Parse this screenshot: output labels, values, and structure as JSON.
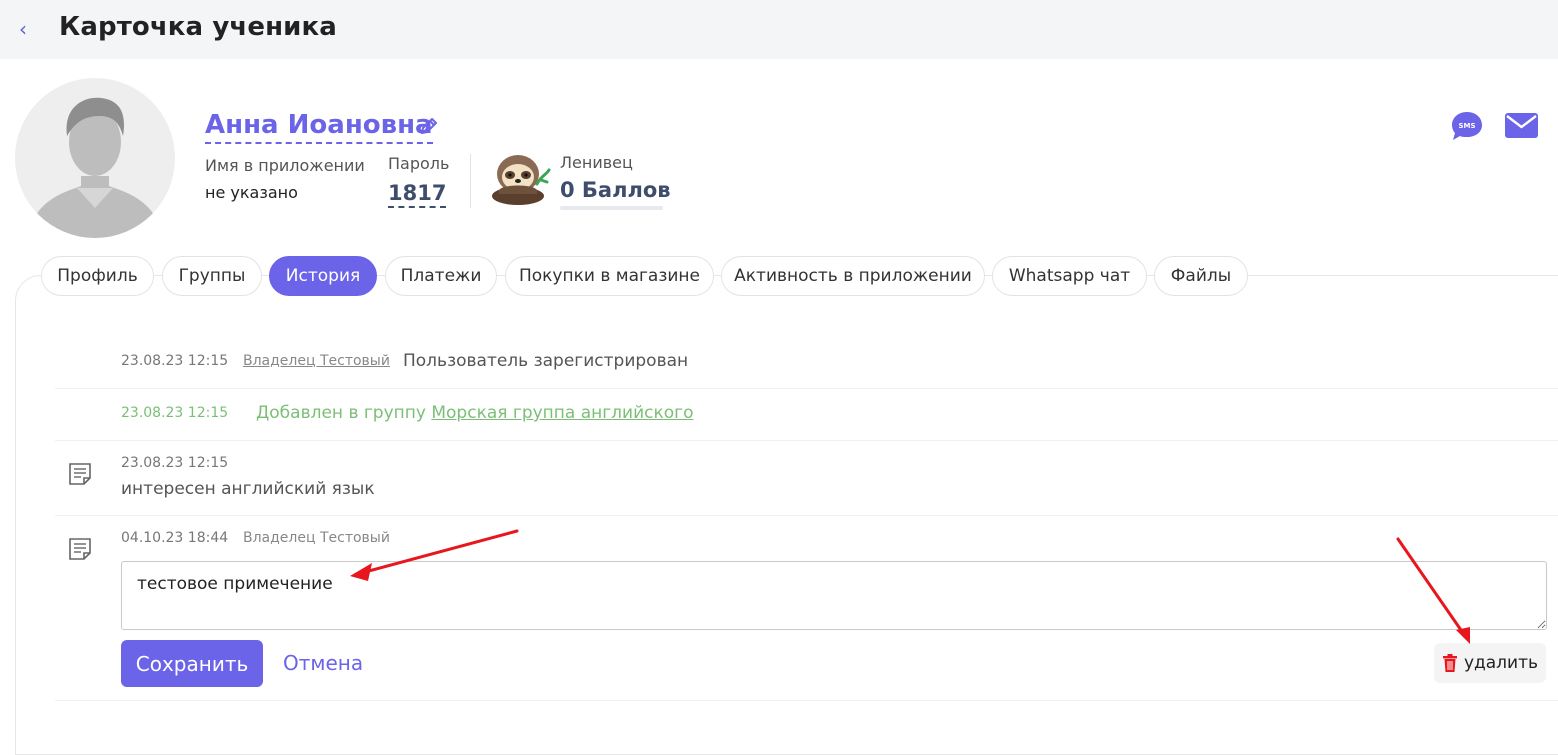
{
  "header": {
    "title": "Карточка ученика",
    "back_icon": "chevron-left-icon"
  },
  "student": {
    "name": "Анна Иоановна",
    "app_name_label": "Имя в приложении",
    "app_name_value": "не указано",
    "password_label": "Пароль",
    "password_value": "1817",
    "level_label": "Ленивец",
    "points_value": "0 Баллов",
    "points_progress": 0
  },
  "contacts": {
    "sms_label": "SMS"
  },
  "tabs": [
    {
      "label": "Профиль",
      "active": false
    },
    {
      "label": "Группы",
      "active": false
    },
    {
      "label": "История",
      "active": true
    },
    {
      "label": "Платежи",
      "active": false
    },
    {
      "label": "Покупки в магазине",
      "active": false
    },
    {
      "label": "Активность в приложении",
      "active": false
    },
    {
      "label": "Whatsapp чат",
      "active": false
    },
    {
      "label": "Файлы",
      "active": false
    }
  ],
  "history": [
    {
      "timestamp": "23.08.23 12:15",
      "author": "Владелец Тестовый",
      "message": "Пользователь зарегистрирован"
    },
    {
      "timestamp": "23.08.23 12:15",
      "message_prefix": "Добавлен в группу",
      "group_link": "Морская группа английского"
    },
    {
      "timestamp": "23.08.23 12:15",
      "note": "интересен английский язык"
    },
    {
      "timestamp": "04.10.23 18:44",
      "author": "Владелец Тестовый",
      "note_value": "тестовое примечение"
    }
  ],
  "editor": {
    "save_label": "Сохранить",
    "cancel_label": "Отмена",
    "delete_label": "удалить"
  },
  "colors": {
    "accent": "#6b63e8",
    "green": "#7bbf77",
    "annotation_red": "#e8171d"
  }
}
